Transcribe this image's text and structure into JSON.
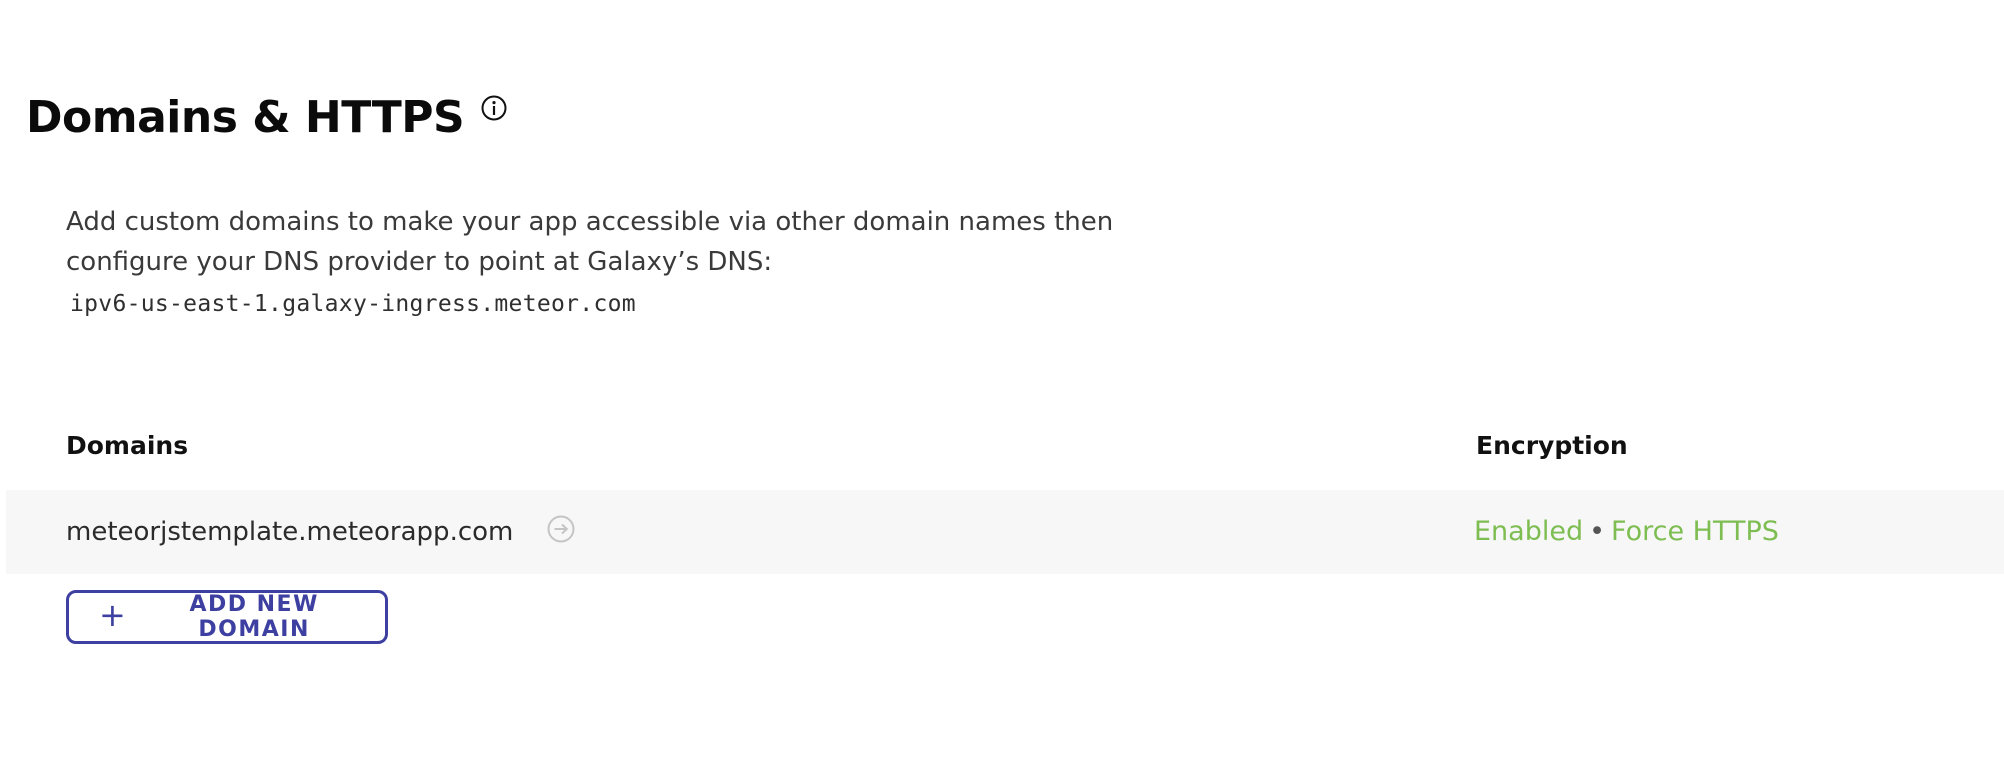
{
  "header": {
    "title": "Domains & HTTPS",
    "info_icon": "info-icon"
  },
  "description": {
    "text": "Add custom domains to make your app accessible via other domain names then configure your DNS provider to point at Galaxy’s DNS:",
    "dns_host": "ipv6-us-east-1.galaxy-ingress.meteor.com"
  },
  "table": {
    "columns": {
      "domains": "Domains",
      "encryption": "Encryption"
    },
    "rows": [
      {
        "domain": "meteorjstemplate.meteorapp.com",
        "open_icon": "arrow-circle-right-icon",
        "encryption_status": "Enabled",
        "separator": "•",
        "force_https": "Force HTTPS"
      }
    ]
  },
  "actions": {
    "add_domain_icon": "+",
    "add_domain_label": "ADD NEW DOMAIN"
  },
  "colors": {
    "accent": "#3d40a0",
    "success": "#7dbd52",
    "row_background": "#f7f7f7"
  }
}
